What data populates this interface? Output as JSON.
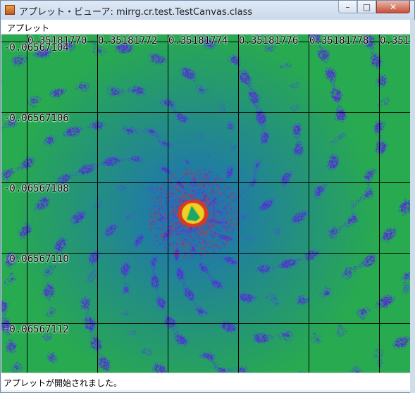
{
  "window": {
    "title": "アプレット・ビューア: mirrg.cr.test.TestCanvas.class",
    "controls": {
      "minimize": "–",
      "maximize": "□",
      "close": "✕"
    }
  },
  "menubar": {
    "items": [
      "アプレット"
    ]
  },
  "canvas": {
    "x_labels": [
      "0.35181770",
      "0.35181772",
      "0.35181774",
      "0.35181776",
      "0.35181778",
      "0.351"
    ],
    "y_labels": [
      "-0.06567104",
      "-0.06567106",
      "-0.06567108",
      "-0.06567110",
      "-0.06567112"
    ],
    "colors": {
      "background_green": "#1aa866",
      "teal": "#1f9c9a",
      "blue": "#3a63c2",
      "purple": "#5a2fd0",
      "center_red": "#d23a2a",
      "center_yellow": "#f0d020",
      "grid_line": "#000000"
    }
  },
  "status": {
    "text": "アプレットが開始されました。"
  }
}
